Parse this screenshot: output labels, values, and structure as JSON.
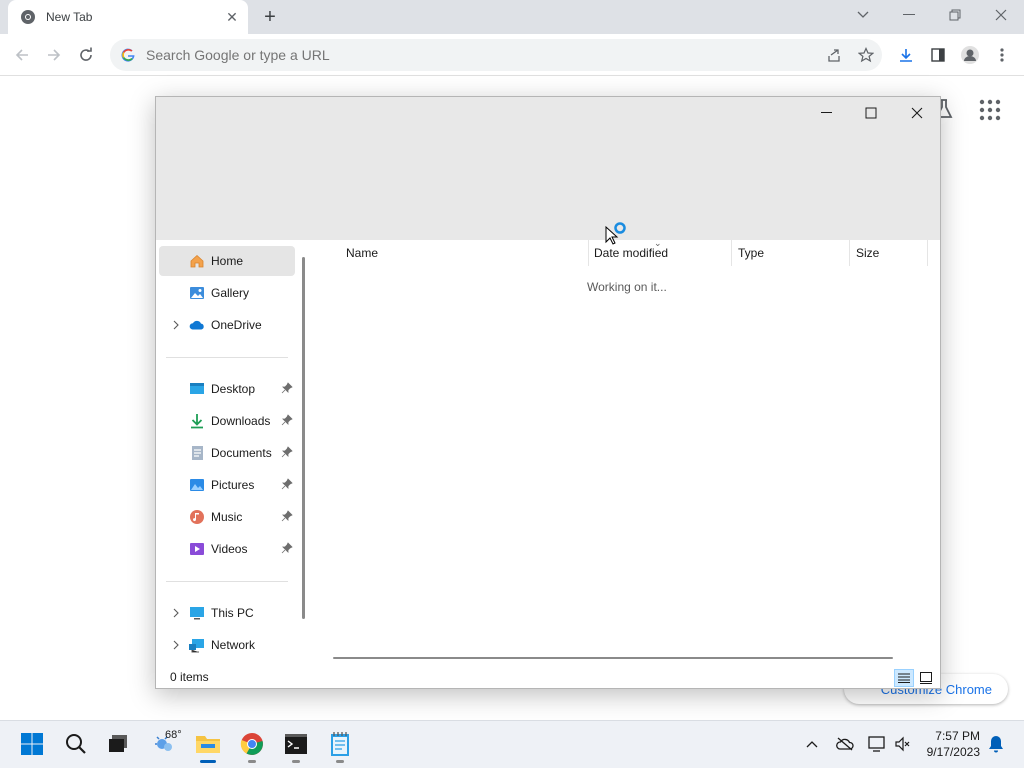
{
  "browser": {
    "tab_title": "New Tab",
    "omnibox_placeholder": "Search Google or type a URL",
    "customize_label": "Customize Chrome"
  },
  "explorer": {
    "nav": {
      "home": "Home",
      "gallery": "Gallery",
      "onedrive": "OneDrive",
      "desktop": "Desktop",
      "downloads": "Downloads",
      "documents": "Documents",
      "pictures": "Pictures",
      "music": "Music",
      "videos": "Videos",
      "this_pc": "This PC",
      "network": "Network"
    },
    "columns": {
      "name": "Name",
      "date_modified": "Date modified",
      "type": "Type",
      "size": "Size"
    },
    "loading_text": "Working on it...",
    "status_text": "0 items"
  },
  "taskbar": {
    "weather_temp": "68°",
    "time": "7:57 PM",
    "date": "9/17/2023"
  },
  "colors": {
    "accent": "#005fb8",
    "chrome_blue": "#1a73e8",
    "tabstrip": "#dee1e6"
  }
}
